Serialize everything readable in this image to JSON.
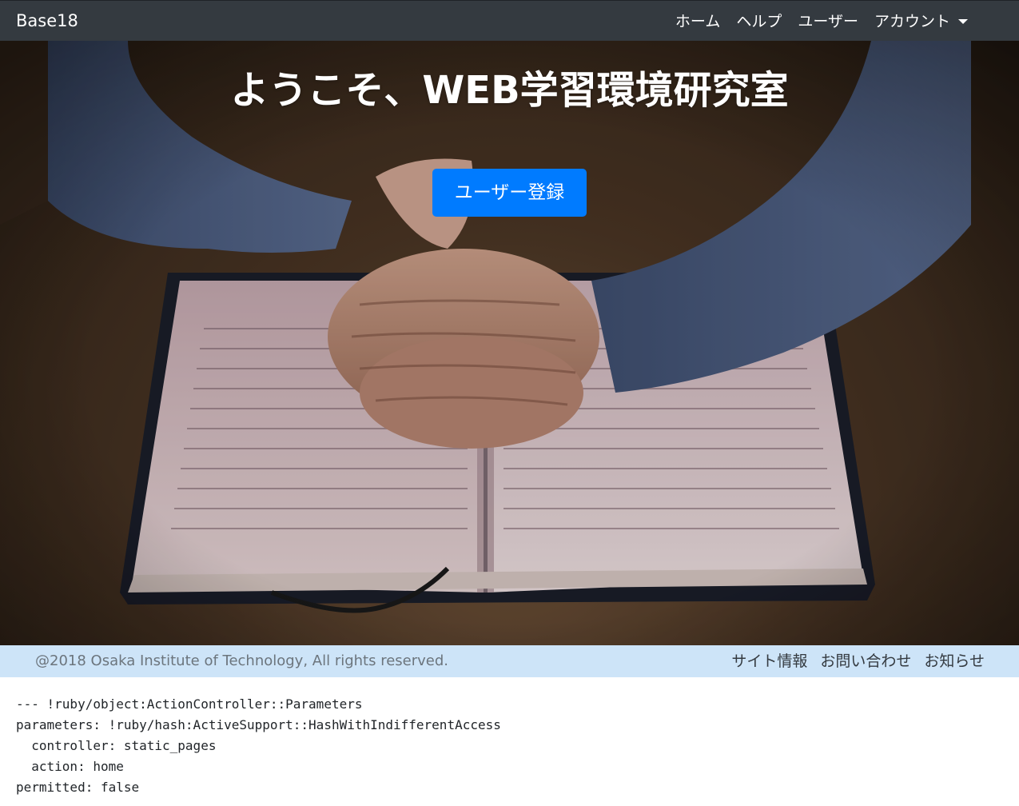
{
  "navbar": {
    "brand": "Base18",
    "links": [
      {
        "label": "ホーム"
      },
      {
        "label": "ヘルプ"
      },
      {
        "label": "ユーザー"
      },
      {
        "label": "アカウント"
      }
    ]
  },
  "hero": {
    "title_prefix": "ようこそ、",
    "title_bold": "WEB",
    "title_suffix": "学習環境研究室",
    "signup_button": "ユーザー登録"
  },
  "footer": {
    "copyright": "@2018 Osaka Institute of Technology, All rights reserved.",
    "links": [
      {
        "label": "サイト情報"
      },
      {
        "label": "お問い合わせ"
      },
      {
        "label": "お知らせ"
      }
    ]
  },
  "debug": {
    "lines": [
      "--- !ruby/object:ActionController::Parameters",
      "parameters: !ruby/hash:ActiveSupport::HashWithIndifferentAccess",
      "  controller: static_pages",
      "  action: home",
      "permitted: false"
    ]
  }
}
